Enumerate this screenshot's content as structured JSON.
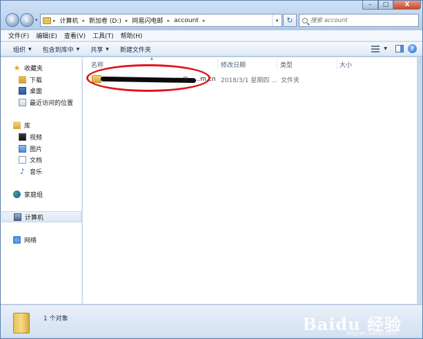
{
  "window": {
    "minimize": "–",
    "maximize": "□",
    "close": "X"
  },
  "address": {
    "crumbs": [
      "计算机",
      "新加卷 (D:)",
      "网易闪电邮",
      "account"
    ]
  },
  "search": {
    "placeholder": "搜索 account"
  },
  "menu": {
    "items": [
      "文件(F)",
      "编辑(E)",
      "查看(V)",
      "工具(T)",
      "帮助(H)"
    ]
  },
  "toolbar": {
    "organize": "组织",
    "include_in_library": "包含到库中",
    "share": "共享",
    "new_folder": "新建文件夹"
  },
  "sidebar": {
    "favorites": "收藏夹",
    "downloads": "下载",
    "desktop": "桌面",
    "recent": "最近访问的位置",
    "libraries": "库",
    "videos": "视频",
    "pictures": "图片",
    "documents": "文档",
    "music": "音乐",
    "homegroup": "家庭组",
    "computer": "计算机",
    "network": "网络"
  },
  "columns": {
    "name": "名称",
    "date": "修改日期",
    "type": "类型",
    "size": "大小"
  },
  "files": [
    {
      "name_visible_tail": "@......m.cn",
      "date": "2018/3/1 星期四 ...",
      "type": "文件夹",
      "size": ""
    }
  ],
  "details": {
    "count": "1 个对象"
  },
  "watermark": {
    "logo": "Baidu 经验",
    "url": "jingyan.baidu.com"
  }
}
